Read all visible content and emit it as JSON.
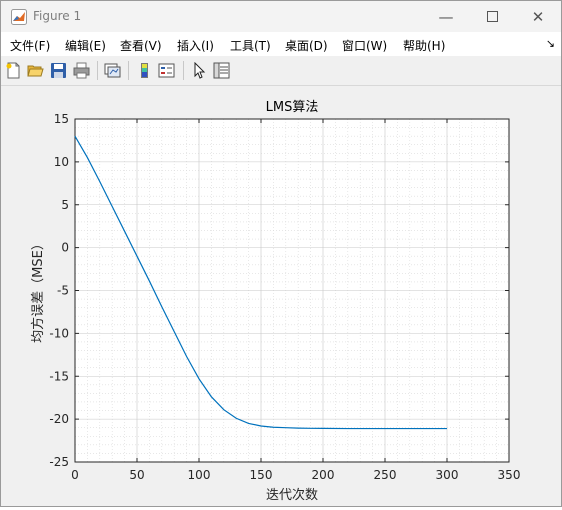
{
  "window": {
    "title": "Figure 1"
  },
  "menu": [
    "文件(F)",
    "编辑(E)",
    "查看(V)",
    "插入(I)",
    "工具(T)",
    "桌面(D)",
    "窗口(W)",
    "帮助(H)"
  ],
  "toolbar_icons": [
    "new-figure-icon",
    "open-file-icon",
    "save-icon",
    "print-icon",
    "link-plot-icon",
    "insert-colorbar-icon",
    "insert-legend-icon",
    "edit-plot-icon",
    "property-inspector-icon"
  ],
  "chart_data": {
    "type": "line",
    "title": "LMS算法",
    "xlabel": "迭代次数",
    "ylabel": "均方误差（MSE）",
    "xlim": [
      0,
      350
    ],
    "ylim": [
      -25,
      15
    ],
    "xticks": [
      0,
      50,
      100,
      150,
      200,
      250,
      300,
      350
    ],
    "yticks": [
      -25,
      -20,
      -15,
      -10,
      -5,
      0,
      5,
      10,
      15
    ],
    "grid": "minor",
    "line_color": "#0072BD",
    "series": [
      {
        "x": [
          0,
          10,
          20,
          30,
          40,
          50,
          60,
          70,
          80,
          90,
          100,
          110,
          120,
          130,
          140,
          150,
          160,
          170,
          180,
          190,
          200,
          220,
          240,
          260,
          280,
          300
        ],
        "values": [
          13,
          10.5,
          7.7,
          4.8,
          1.9,
          -1.0,
          -3.9,
          -6.9,
          -9.8,
          -12.7,
          -15.3,
          -17.4,
          -18.9,
          -19.9,
          -20.5,
          -20.8,
          -20.95,
          -21.0,
          -21.05,
          -21.07,
          -21.08,
          -21.1,
          -21.1,
          -21.1,
          -21.1,
          -21.1
        ]
      }
    ]
  }
}
